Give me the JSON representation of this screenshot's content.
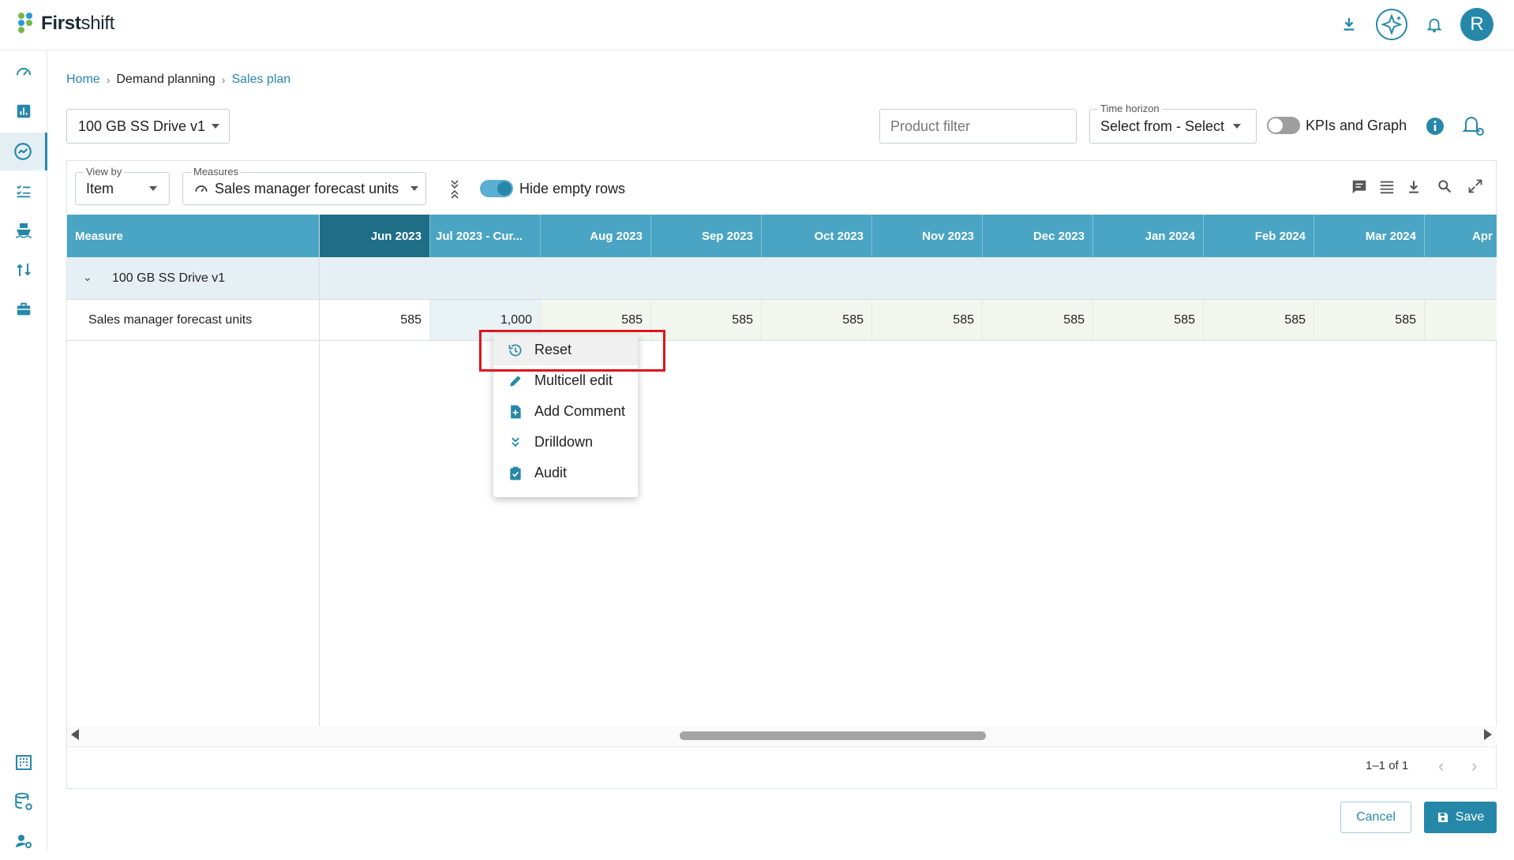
{
  "app": {
    "logo_bold": "First",
    "logo_light": "shift",
    "avatar_letter": "R"
  },
  "breadcrumb": {
    "home": "Home",
    "parent": "Demand planning",
    "current": "Sales plan"
  },
  "plan_selector": {
    "value": "100 GB SS Drive v1"
  },
  "product_filter": {
    "placeholder": "Product filter"
  },
  "time_horizon": {
    "label": "Time horizon",
    "value": "Select from - Select"
  },
  "kpi_toggle": {
    "label": "KPIs and Graph",
    "on": false
  },
  "view_by": {
    "label": "View by",
    "value": "Item"
  },
  "measures": {
    "label": "Measures",
    "value": "Sales manager forecast units"
  },
  "hide_empty": {
    "label": "Hide empty rows",
    "on": true
  },
  "grid": {
    "measure_header": "Measure",
    "columns": [
      "Jun 2023",
      "Jul 2023 - Cur...",
      "Aug 2023",
      "Sep 2023",
      "Oct 2023",
      "Nov 2023",
      "Dec 2023",
      "Jan 2024",
      "Feb 2024",
      "Mar 2024",
      "Apr"
    ],
    "group": "100 GB SS Drive v1",
    "row_label": "Sales manager forecast units",
    "row_values": [
      "585",
      "1,000",
      "585",
      "585",
      "585",
      "585",
      "585",
      "585",
      "585",
      "585",
      ""
    ]
  },
  "context_menu": [
    "Reset",
    "Multicell edit",
    "Add Comment",
    "Drilldown",
    "Audit"
  ],
  "pagination": {
    "text": "1–1 of 1"
  },
  "buttons": {
    "cancel": "Cancel",
    "save": "Save"
  },
  "colors": {
    "primary": "#2688a8",
    "header": "#4aa5c4",
    "header_dark": "#1f6e87",
    "highlight": "#e0141c"
  }
}
